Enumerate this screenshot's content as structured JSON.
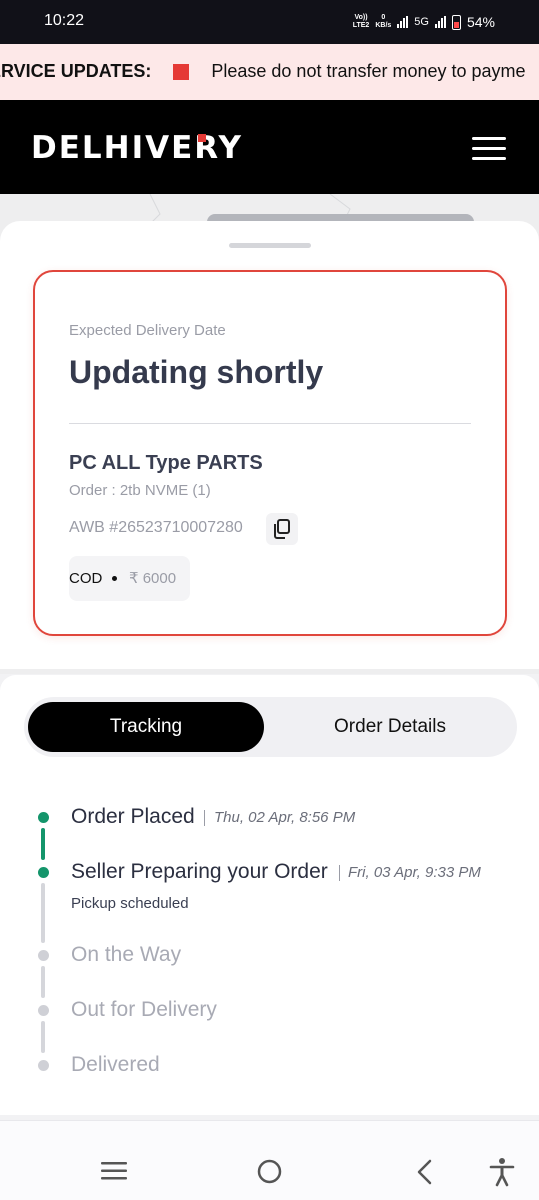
{
  "status_bar": {
    "time": "10:22",
    "network_top": "Vo))",
    "network_bottom": "LTE2",
    "speed_top": "0",
    "speed_bottom": "KB/s",
    "network_type": "5G",
    "battery": "54%"
  },
  "banner": {
    "title": "ERVICE UPDATES:",
    "message": "Please do not transfer money to payme",
    "accent_color": "#e53935"
  },
  "header": {
    "logo": "DELHIVERY",
    "menu_icon": "hamburger-menu-icon"
  },
  "shipment": {
    "expected_label": "Expected Delivery Date",
    "expected_value": "Updating shortly",
    "product": "PC ALL Type PARTS",
    "order": "Order : 2tb NVME (1)",
    "awb": "AWB #26523710007280",
    "payment_mode": "COD",
    "amount": "₹ 6000"
  },
  "tabs": {
    "active": "Tracking",
    "inactive": "Order Details"
  },
  "timeline": [
    {
      "title": "Order Placed",
      "time": "Thu, 02 Apr, 8:56 PM",
      "status": "done"
    },
    {
      "title": "Seller Preparing your Order",
      "time": "Fri, 03 Apr, 9:33 PM",
      "sub": "Pickup scheduled",
      "status": "done"
    },
    {
      "title": "On the Way",
      "status": "pending"
    },
    {
      "title": "Out for Delivery",
      "status": "pending"
    },
    {
      "title": "Delivered",
      "status": "pending"
    }
  ],
  "colors": {
    "done": "#14956b",
    "pending": "#cfd0d6",
    "card_border": "#e0463c"
  }
}
